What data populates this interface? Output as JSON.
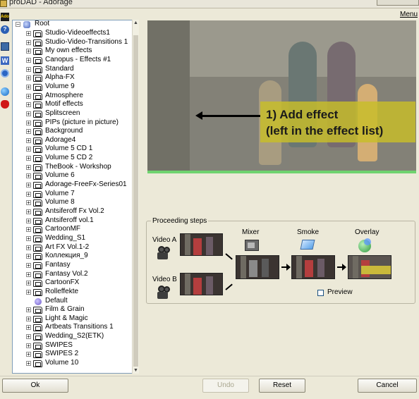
{
  "window": {
    "title": "proDAD - Adorage",
    "menu_label": "Menu",
    "app_icon": "adorage-app-icon"
  },
  "toolbar": {
    "icons": [
      "adorage-logo-icon",
      "help-icon",
      "monitor-icon",
      "w-icon",
      "settings-gear-icon",
      "blue-ball-icon",
      "bug-icon"
    ],
    "logo_text": "Ado",
    "help_text": "?",
    "w_text": "W"
  },
  "tree": {
    "root_label": "Root",
    "items": [
      "Studio-Videoeffects1",
      "Studio-Video-Transitions 1",
      "My own effects",
      "Canopus - Effects #1",
      "Standard",
      "Alpha-FX",
      "Volume 9",
      "Atmosphere",
      "Motif effects",
      "Splitscreen",
      "PIPs (picture in picture)",
      "Background",
      "Adorage4",
      "Volume 5 CD 1",
      "Volume 5 CD 2",
      "TheBook - Workshop",
      "Volume 6",
      "Adorage-FreeFx-Series01",
      "Volume 7",
      "Volume 8",
      "Antsiferoff  Fx Vol.2",
      "Antsiferoff vol.1",
      "CartoonMF",
      "Wedding_S1",
      "Art FX Vol.1-2",
      "Коллекция_9",
      "Fantasy",
      "Fantasy Vol.2",
      "CartoonFX",
      "Rolleffekte",
      "Default",
      "Film & Grain",
      "Light & Magic",
      "Artbeats Transitions 1",
      "Wedding_S2(ETK)",
      "SWIPES",
      "SWIPES 2",
      "Volume 10"
    ]
  },
  "preview": {
    "callout": "1) Add effect\n(left in the effect list)",
    "progress_percent": 100
  },
  "steps": {
    "group_title": "Proceeding steps",
    "video_a": "Video A",
    "video_b": "Video B",
    "mixer": "Mixer",
    "smoke": "Smoke",
    "overlay": "Overlay",
    "preview_checkbox_label": "Preview",
    "preview_checked": false
  },
  "buttons": {
    "ok": "Ok",
    "undo": "Undo",
    "reset": "Reset",
    "cancel": "Cancel"
  },
  "colors": {
    "progress": "#6fd36f",
    "callout": "#c8be28",
    "tree_border": "#7f9db9"
  }
}
